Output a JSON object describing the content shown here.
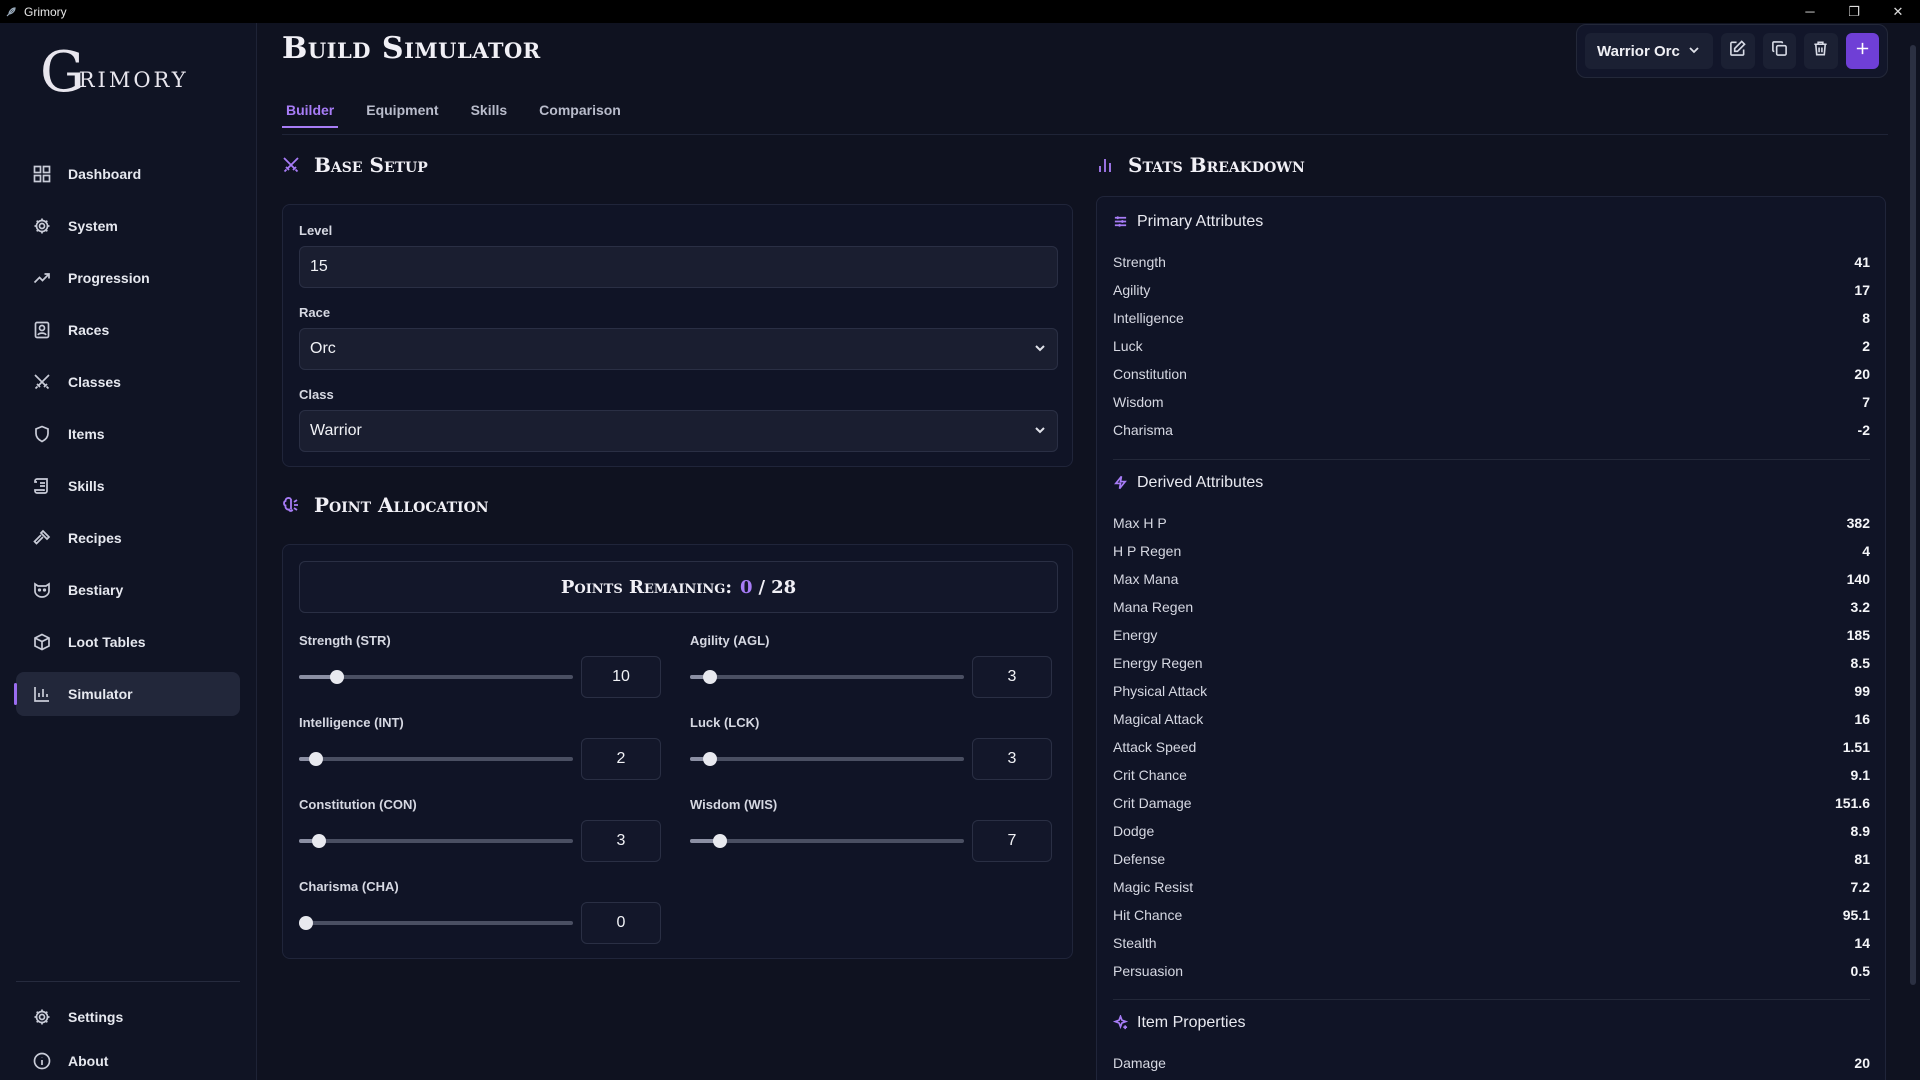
{
  "window": {
    "app_icon": "feather-icon",
    "title": "Grimory",
    "minimize": "─",
    "restore": "❐",
    "close": "✕"
  },
  "logo": {
    "first": "G",
    "rest": "rimory"
  },
  "sidebar": {
    "items": [
      {
        "label": "Dashboard",
        "icon": "dashboard-icon"
      },
      {
        "label": "System",
        "icon": "gear-icon"
      },
      {
        "label": "Progression",
        "icon": "trending-up-icon"
      },
      {
        "label": "Races",
        "icon": "contact-card-icon"
      },
      {
        "label": "Classes",
        "icon": "crossed-swords-icon"
      },
      {
        "label": "Items",
        "icon": "shield-icon"
      },
      {
        "label": "Skills",
        "icon": "scroll-icon"
      },
      {
        "label": "Recipes",
        "icon": "hammer-icon"
      },
      {
        "label": "Bestiary",
        "icon": "beast-icon"
      },
      {
        "label": "Loot Tables",
        "icon": "package-icon"
      },
      {
        "label": "Simulator",
        "icon": "bar-chart-icon",
        "active": true
      }
    ],
    "bottom": [
      {
        "label": "Settings",
        "icon": "gear-icon"
      },
      {
        "label": "About",
        "icon": "info-icon"
      }
    ]
  },
  "page": {
    "title": "Build Simulator",
    "tabs": [
      "Builder",
      "Equipment",
      "Skills",
      "Comparison"
    ],
    "active_tab": "Builder"
  },
  "toolbar": {
    "build_name": "Warrior Orc",
    "chevron": "⌄"
  },
  "base_setup": {
    "heading": "Base Setup",
    "level_label": "Level",
    "level_value": "15",
    "race_label": "Race",
    "race_value": "Orc",
    "class_label": "Class",
    "class_value": "Warrior"
  },
  "point_allocation": {
    "heading": "Point Allocation",
    "remaining_label": "Points Remaining:",
    "remaining_current": "0",
    "remaining_separator": "/",
    "remaining_total": "28",
    "slider_max": 30,
    "stats": [
      {
        "label": "Strength (STR)",
        "value": "10",
        "fraction": 0.12
      },
      {
        "label": "Agility (AGL)",
        "value": "3",
        "fraction": 0.05
      },
      {
        "label": "Intelligence (INT)",
        "value": "2",
        "fraction": 0.04
      },
      {
        "label": "Luck (LCK)",
        "value": "3",
        "fraction": 0.05
      },
      {
        "label": "Constitution (CON)",
        "value": "3",
        "fraction": 0.05
      },
      {
        "label": "Wisdom (WIS)",
        "value": "7",
        "fraction": 0.09
      },
      {
        "label": "Charisma (CHA)",
        "value": "0",
        "fraction": 0.0
      }
    ]
  },
  "stats_breakdown": {
    "heading": "Stats Breakdown",
    "primary": {
      "title": "Primary Attributes",
      "rows": [
        {
          "k": "Strength",
          "v": "41"
        },
        {
          "k": "Agility",
          "v": "17"
        },
        {
          "k": "Intelligence",
          "v": "8"
        },
        {
          "k": "Luck",
          "v": "2"
        },
        {
          "k": "Constitution",
          "v": "20"
        },
        {
          "k": "Wisdom",
          "v": "7"
        },
        {
          "k": "Charisma",
          "v": "-2"
        }
      ]
    },
    "derived": {
      "title": "Derived Attributes",
      "rows": [
        {
          "k": "Max H P",
          "v": "382"
        },
        {
          "k": "H P Regen",
          "v": "4"
        },
        {
          "k": "Max Mana",
          "v": "140"
        },
        {
          "k": "Mana Regen",
          "v": "3.2"
        },
        {
          "k": "Energy",
          "v": "185"
        },
        {
          "k": "Energy Regen",
          "v": "8.5"
        },
        {
          "k": "Physical Attack",
          "v": "99"
        },
        {
          "k": "Magical Attack",
          "v": "16"
        },
        {
          "k": "Attack Speed",
          "v": "1.51"
        },
        {
          "k": "Crit Chance",
          "v": "9.1"
        },
        {
          "k": "Crit Damage",
          "v": "151.6"
        },
        {
          "k": "Dodge",
          "v": "8.9"
        },
        {
          "k": "Defense",
          "v": "81"
        },
        {
          "k": "Magic Resist",
          "v": "7.2"
        },
        {
          "k": "Hit Chance",
          "v": "95.1"
        },
        {
          "k": "Stealth",
          "v": "14"
        },
        {
          "k": "Persuasion",
          "v": "0.5"
        }
      ]
    },
    "item_properties": {
      "title": "Item Properties",
      "rows": [
        {
          "k": "Damage",
          "v": "20"
        }
      ]
    }
  },
  "colors": {
    "accent": "#a77cf6",
    "primary_button": "#6f3fd6",
    "background": "#0f1220"
  }
}
